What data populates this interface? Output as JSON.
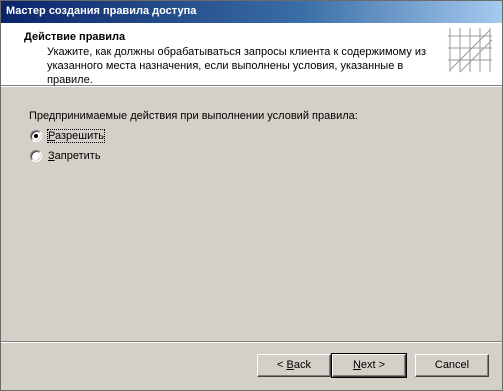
{
  "window": {
    "title": "Мастер создания правила доступа"
  },
  "header": {
    "title": "Действие правила",
    "description": "Укажите, как должны обрабатываться запросы клиента к содержимому из указанного места назначения, если выполнены условия, указанные в правиле."
  },
  "content": {
    "prompt": "Предпринимаемые действия при выполнении условий правила:",
    "options": [
      {
        "label": "Разрешить",
        "underline_char": "Р",
        "rest": "азрешить",
        "checked": true
      },
      {
        "label": "Запретить",
        "underline_char": "З",
        "rest": "апретить",
        "checked": false
      }
    ]
  },
  "buttons": {
    "back": {
      "label": "< Back",
      "prefix": "< ",
      "underline": "B",
      "rest": "ack"
    },
    "next": {
      "label": "Next >",
      "prefix": "",
      "underline": "N",
      "rest": "ext >"
    },
    "cancel": {
      "label": "Cancel"
    }
  }
}
